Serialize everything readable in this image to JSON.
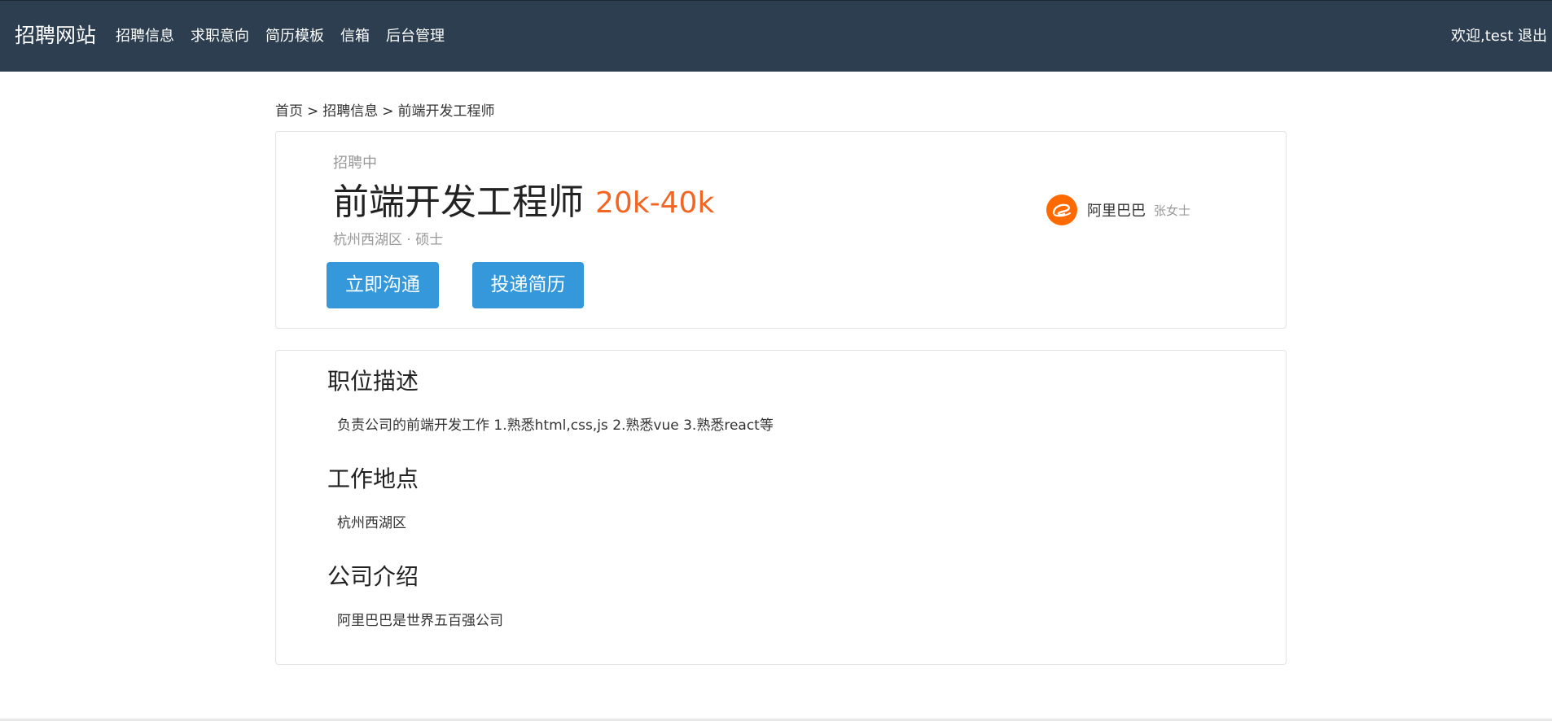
{
  "nav": {
    "brand": "招聘网站",
    "items": [
      "招聘信息",
      "求职意向",
      "简历模板",
      "信箱",
      "后台管理"
    ],
    "welcome": "欢迎,test",
    "logout": "退出"
  },
  "breadcrumb": [
    "首页",
    "招聘信息",
    "前端开发工程师"
  ],
  "breadcrumb_sep": ">",
  "job": {
    "status": "招聘中",
    "title": "前端开发工程师",
    "salary": "20k-40k",
    "location": "杭州西湖区",
    "separator": "·",
    "education": "硕士",
    "chat_button": "立即沟通",
    "resume_button": "投递简历"
  },
  "company": {
    "name": "阿里巴巴",
    "contact": "张女士",
    "logo_icon": "alibaba-logo-icon",
    "brand_color": "#ff6a00"
  },
  "sections": [
    {
      "title": "职位描述",
      "body": "负责公司的前端开发工作 1.熟悉html,css,js 2.熟悉vue 3.熟悉react等"
    },
    {
      "title": "工作地点",
      "body": "杭州西湖区"
    },
    {
      "title": "公司介绍",
      "body": "阿里巴巴是世界五百强公司"
    }
  ],
  "colors": {
    "navbar": "#2c3e50",
    "accent": "#3498db",
    "salary": "#f26522"
  }
}
